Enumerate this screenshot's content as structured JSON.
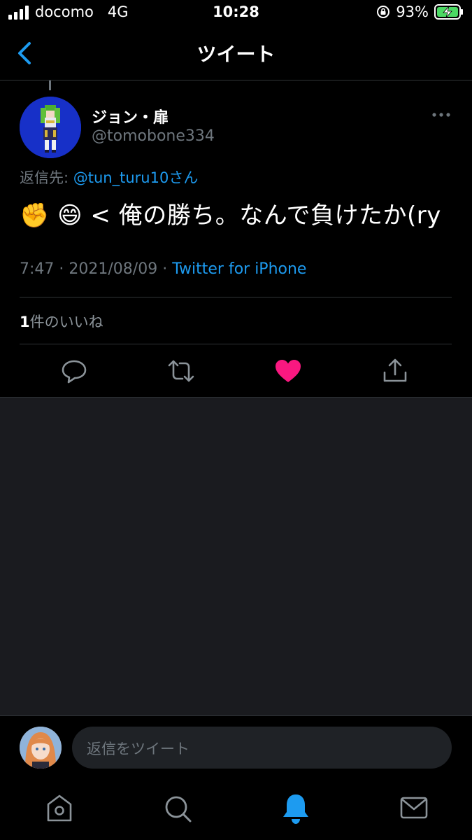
{
  "status_bar": {
    "carrier": "docomo",
    "network": "4G",
    "time": "10:28",
    "battery": "93%"
  },
  "header": {
    "title": "ツイート",
    "back_icon": "chevron-left-icon"
  },
  "tweet": {
    "author_name": "ジョン・扉",
    "author_handle": "@tomobone334",
    "reply_to_label": "返信先:",
    "reply_to_mention": "@tun_turu10さん",
    "text": "✊ 😄 < 俺の勝ち。なんで負けたか(ry",
    "time": "7:47",
    "date": "2021/08/09",
    "separator": "·",
    "source": "Twitter for iPhone",
    "like_count": "1",
    "like_suffix": "件のいいね",
    "liked": true
  },
  "reply_composer": {
    "placeholder": "返信をツイート"
  },
  "tab_bar": {
    "items": [
      "home-icon",
      "search-icon",
      "notifications-icon",
      "messages-icon"
    ],
    "active": "notifications-icon"
  },
  "colors": {
    "accent": "#1d9bf0",
    "like": "#f91880",
    "background": "#000000",
    "muted": "#6e767d"
  }
}
